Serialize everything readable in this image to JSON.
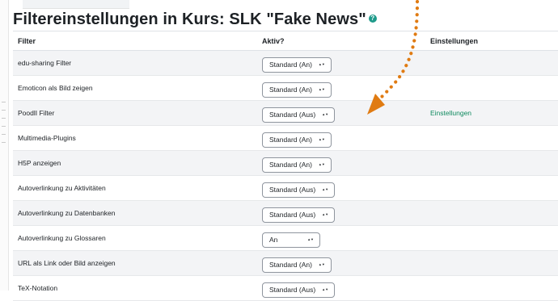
{
  "page": {
    "title": "Filtereinstellungen in Kurs: SLK \"Fake News\"",
    "help_icon": "question-circle-icon",
    "accent": "#1e9a8a"
  },
  "table": {
    "headers": [
      "Filter",
      "Aktiv?",
      "Einstellungen"
    ],
    "rows": [
      {
        "filter": "edu-sharing Filter",
        "active": "Standard (An)",
        "settings": ""
      },
      {
        "filter": "Emoticon als Bild zeigen",
        "active": "Standard (An)",
        "settings": ""
      },
      {
        "filter": "PoodlI Filter",
        "active": "Standard (Aus)",
        "settings": "Einstellungen"
      },
      {
        "filter": "Multimedia-Plugins",
        "active": "Standard (An)",
        "settings": ""
      },
      {
        "filter": "H5P anzeigen",
        "active": "Standard (An)",
        "settings": ""
      },
      {
        "filter": "Autoverlinkung zu Aktivitäten",
        "active": "Standard (Aus)",
        "settings": ""
      },
      {
        "filter": "Autoverlinkung zu Datenbanken",
        "active": "Standard (Aus)",
        "settings": ""
      },
      {
        "filter": "Autoverlinkung zu Glossaren",
        "active": "An",
        "settings": ""
      },
      {
        "filter": "URL als Link oder Bild anzeigen",
        "active": "Standard (An)",
        "settings": ""
      },
      {
        "filter": "TeX-Notation",
        "active": "Standard (Aus)",
        "settings": ""
      }
    ]
  },
  "annotation": {
    "arrow_color": "#e07b12"
  },
  "link_color": "#0f8a5f"
}
